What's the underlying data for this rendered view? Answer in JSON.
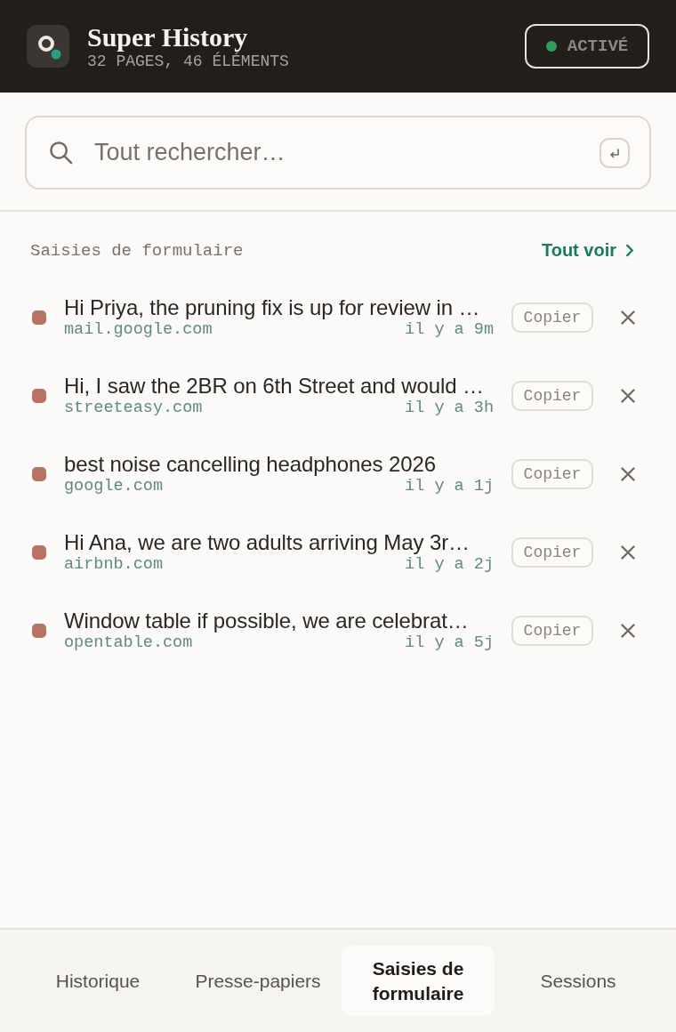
{
  "header": {
    "title": "Super History",
    "subtitle": "32 PAGES, 46 ÉLÉMENTS",
    "status": {
      "label": "ACTIVÉ",
      "on": true
    }
  },
  "search": {
    "placeholder": "Tout rechercher…"
  },
  "section": {
    "title": "Saisies de formulaire",
    "link": "Tout voir"
  },
  "entries": [
    {
      "text": "Hi Priya, the pruning fix is up for review in …",
      "domain": "mail.google.com",
      "time": "il y a 9m",
      "action": "Copier"
    },
    {
      "text": "Hi, I saw the 2BR on 6th Street and would …",
      "domain": "streeteasy.com",
      "time": "il y a 3h",
      "action": "Copier"
    },
    {
      "text": "best noise cancelling headphones 2026",
      "domain": "google.com",
      "time": "il y a 1j",
      "action": "Copier"
    },
    {
      "text": "Hi Ana, we are two adults arriving May 3r…",
      "domain": "airbnb.com",
      "time": "il y a 2j",
      "action": "Copier"
    },
    {
      "text": "Window table if possible, we are celebrat…",
      "domain": "opentable.com",
      "time": "il y a 5j",
      "action": "Copier"
    }
  ],
  "tabs": [
    {
      "label": "Historique",
      "selected": false
    },
    {
      "label": "Presse-papiers",
      "selected": false
    },
    {
      "label": "Saisies de formulaire",
      "selected": true
    },
    {
      "label": "Sessions",
      "selected": false
    }
  ]
}
